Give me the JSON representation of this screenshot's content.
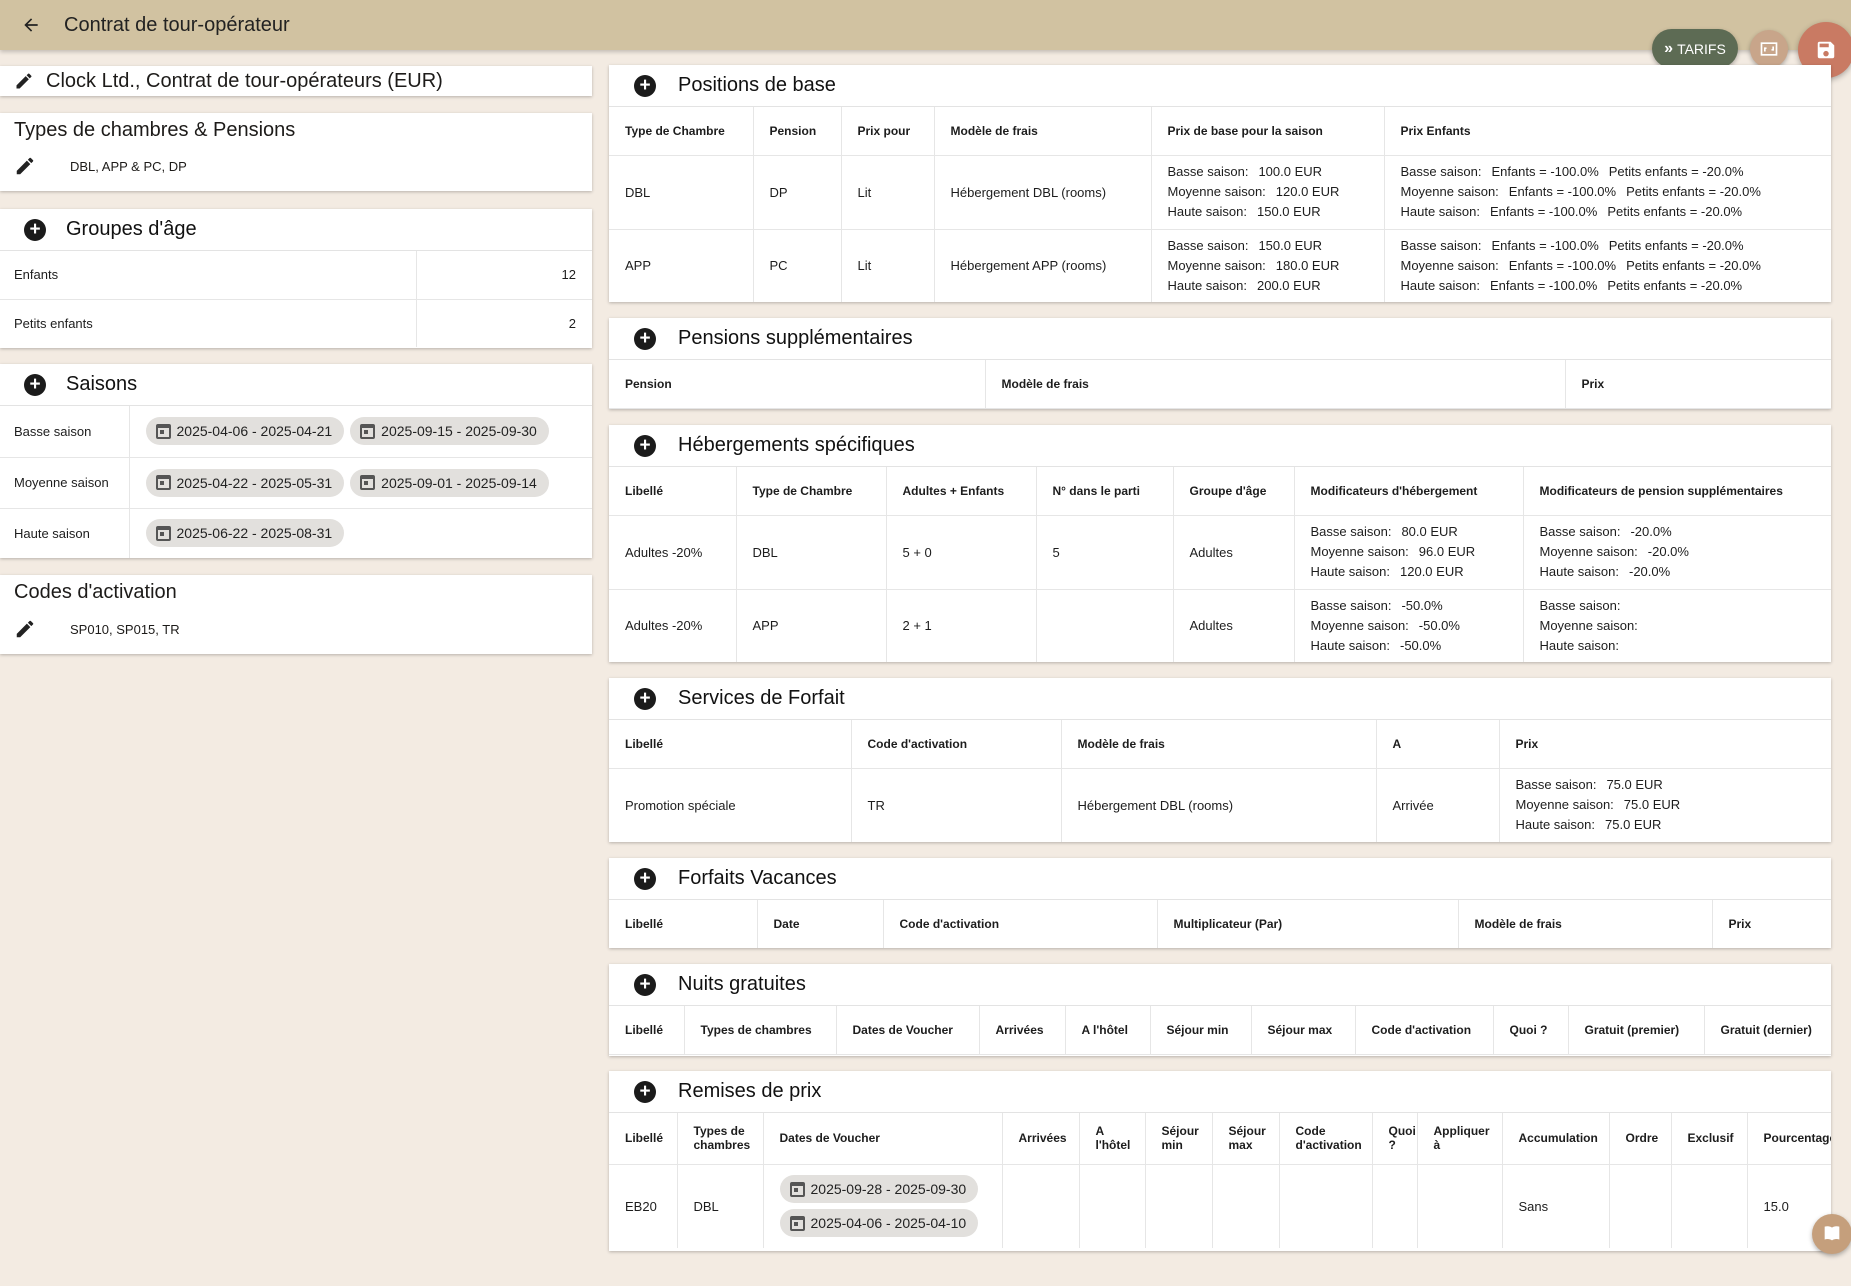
{
  "topbar": {
    "title": "Contrat de tour-opérateur"
  },
  "fab": {
    "tarifs_label": "TARIFS"
  },
  "contract": {
    "title": "Clock Ltd., Contrat de tour-opérateurs (EUR)"
  },
  "room_types": {
    "heading": "Types de chambres & Pensions",
    "value": "DBL, APP & PC, DP"
  },
  "age_groups": {
    "heading": "Groupes d'âge",
    "rows": [
      {
        "label": "Enfants",
        "value": "12"
      },
      {
        "label": "Petits enfants",
        "value": "2"
      }
    ]
  },
  "seasons": {
    "heading": "Saisons",
    "rows": [
      {
        "label": "Basse saison",
        "dates": [
          "2025-04-06 - 2025-04-21",
          "2025-09-15 - 2025-09-30"
        ]
      },
      {
        "label": "Moyenne saison",
        "dates": [
          "2025-04-22 - 2025-05-31",
          "2025-09-01 - 2025-09-14"
        ]
      },
      {
        "label": "Haute saison",
        "dates": [
          "2025-06-22 - 2025-08-31"
        ]
      }
    ]
  },
  "activation_codes": {
    "heading": "Codes d'activation",
    "value": "SP010, SP015, TR"
  },
  "base_positions": {
    "heading": "Positions de base",
    "columns": [
      "Type de Chambre",
      "Pension",
      "Prix pour",
      "Modèle de frais",
      "Prix de base pour la saison",
      "Prix Enfants"
    ],
    "rows": [
      {
        "room": "DBL",
        "pension": "DP",
        "price_for": "Lit",
        "fee_model": "Hébergement DBL (rooms)",
        "base": [
          [
            "Basse saison:",
            "100.0 EUR"
          ],
          [
            "Moyenne saison:",
            "120.0 EUR"
          ],
          [
            "Haute saison:",
            "150.0 EUR"
          ]
        ],
        "children": [
          [
            "Basse saison:",
            "Enfants = -100.0%",
            "Petits enfants = -20.0%"
          ],
          [
            "Moyenne saison:",
            "Enfants = -100.0%",
            "Petits enfants = -20.0%"
          ],
          [
            "Haute saison:",
            "Enfants = -100.0%",
            "Petits enfants = -20.0%"
          ]
        ]
      },
      {
        "room": "APP",
        "pension": "PC",
        "price_for": "Lit",
        "fee_model": "Hébergement APP (rooms)",
        "base": [
          [
            "Basse saison:",
            "150.0 EUR"
          ],
          [
            "Moyenne saison:",
            "180.0 EUR"
          ],
          [
            "Haute saison:",
            "200.0 EUR"
          ]
        ],
        "children": [
          [
            "Basse saison:",
            "Enfants = -100.0%",
            "Petits enfants = -20.0%"
          ],
          [
            "Moyenne saison:",
            "Enfants = -100.0%",
            "Petits enfants = -20.0%"
          ],
          [
            "Haute saison:",
            "Enfants = -100.0%",
            "Petits enfants = -20.0%"
          ]
        ]
      }
    ]
  },
  "extra_pensions": {
    "heading": "Pensions supplémentaires",
    "columns": [
      "Pension",
      "Modèle de frais",
      "Prix"
    ]
  },
  "specific_accommodations": {
    "heading": "Hébergements spécifiques",
    "columns": [
      "Libellé",
      "Type de Chambre",
      "Adultes + Enfants",
      "N° dans le parti",
      "Groupe d'âge",
      "Modificateurs d'hébergement",
      "Modificateurs de pension supplémentaires"
    ],
    "rows": [
      {
        "label": "Adultes -20%",
        "room": "DBL",
        "pax": "5 + 0",
        "nr": "5",
        "age_group": "Adultes",
        "mods": [
          [
            "Basse saison:",
            "80.0 EUR"
          ],
          [
            "Moyenne saison:",
            "96.0 EUR"
          ],
          [
            "Haute saison:",
            "120.0 EUR"
          ]
        ],
        "pension_mods": [
          [
            "Basse saison:",
            "-20.0%"
          ],
          [
            "Moyenne saison:",
            "-20.0%"
          ],
          [
            "Haute saison:",
            "-20.0%"
          ]
        ]
      },
      {
        "label": "Adultes -20%",
        "room": "APP",
        "pax": "2 + 1",
        "nr": "",
        "age_group": "Adultes",
        "mods": [
          [
            "Basse saison:",
            "-50.0%"
          ],
          [
            "Moyenne saison:",
            "-50.0%"
          ],
          [
            "Haute saison:",
            "-50.0%"
          ]
        ],
        "pension_mods": [
          [
            "Basse saison:",
            ""
          ],
          [
            "Moyenne saison:",
            ""
          ],
          [
            "Haute saison:",
            ""
          ]
        ]
      }
    ]
  },
  "package_services": {
    "heading": "Services de Forfait",
    "columns": [
      "Libellé",
      "Code d'activation",
      "Modèle de frais",
      "A",
      "Prix"
    ],
    "rows": [
      {
        "label": "Promotion spéciale",
        "code": "TR",
        "fee_model": "Hébergement DBL (rooms)",
        "a": "Arrivée",
        "price": [
          [
            "Basse saison:",
            "75.0 EUR"
          ],
          [
            "Moyenne saison:",
            "75.0 EUR"
          ],
          [
            "Haute saison:",
            "75.0 EUR"
          ]
        ]
      }
    ]
  },
  "holiday_packages": {
    "heading": "Forfaits Vacances",
    "columns": [
      "Libellé",
      "Date",
      "Code d'activation",
      "Multiplicateur (Par)",
      "Modèle de frais",
      "Prix"
    ]
  },
  "free_nights": {
    "heading": "Nuits gratuites",
    "columns": [
      "Libellé",
      "Types de chambres",
      "Dates de Voucher",
      "Arrivées",
      "A l'hôtel",
      "Séjour min",
      "Séjour max",
      "Code d'activation",
      "Quoi ?",
      "Gratuit (premier)",
      "Gratuit (dernier)"
    ]
  },
  "discounts": {
    "heading": "Remises de prix",
    "columns": [
      "Libellé",
      "Types de chambres",
      "Dates de Voucher",
      "Arrivées",
      "A l'hôtel",
      "Séjour min",
      "Séjour max",
      "Code d'activation",
      "Quoi ?",
      "Appliquer à",
      "Accumulation",
      "Ordre",
      "Exclusif",
      "Pourcentage"
    ],
    "rows": [
      {
        "label": "EB20",
        "room": "DBL",
        "dates": [
          "2025-09-28 - 2025-09-30",
          "2025-04-06 - 2025-04-10"
        ],
        "accumulation": "Sans",
        "percentage": "15.0"
      }
    ]
  }
}
